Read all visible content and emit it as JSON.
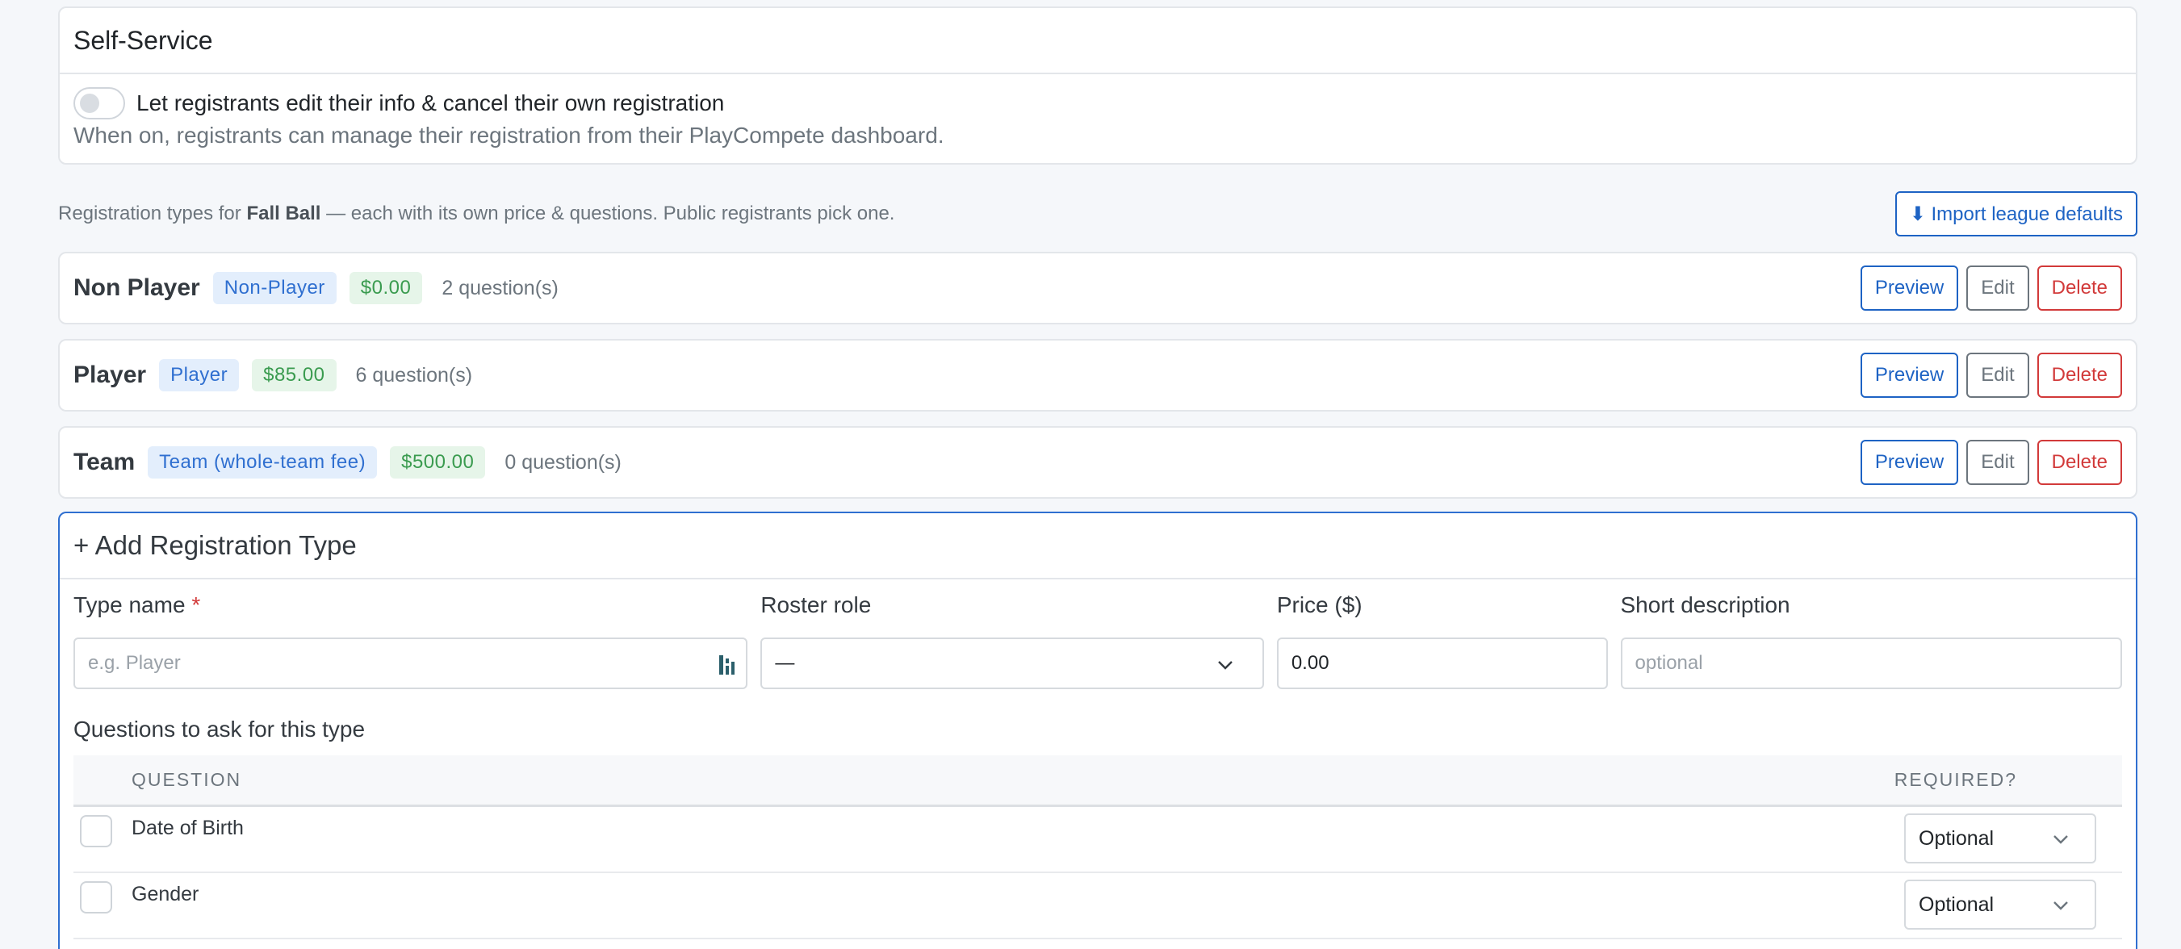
{
  "self_service": {
    "title": "Self-Service",
    "toggle_label": "Let registrants edit their info & cancel their own registration",
    "toggle_on": false,
    "help": "When on, registrants can manage their registration from their PlayCompete dashboard."
  },
  "intro": {
    "prefix": "Registration types for ",
    "league": "Fall Ball",
    "suffix": " — each with its own price & questions. Public registrants pick one.",
    "import_button": "⬇ Import league defaults"
  },
  "types": [
    {
      "name": "Non Player",
      "role": "Non-Player",
      "price": "$0.00",
      "questions": "2 question(s)"
    },
    {
      "name": "Player",
      "role": "Player",
      "price": "$85.00",
      "questions": "6 question(s)"
    },
    {
      "name": "Team",
      "role": "Team (whole-team fee)",
      "price": "$500.00",
      "questions": "0 question(s)"
    }
  ],
  "actions": {
    "preview": "Preview",
    "edit": "Edit",
    "delete": "Delete"
  },
  "add_form": {
    "title": "+ Add Registration Type",
    "type_name_label": "Type name",
    "required_mark": "*",
    "type_name_placeholder": "e.g. Player",
    "roster_role_label": "Roster role",
    "roster_role_value": "—",
    "price_label": "Price ($)",
    "price_value": "0.00",
    "short_desc_label": "Short description",
    "short_desc_placeholder": "optional",
    "questions_title": "Questions to ask for this type",
    "col_question": "QUESTION",
    "col_required": "REQUIRED?",
    "questions": [
      {
        "label": "Date of Birth",
        "required": "Optional"
      },
      {
        "label": "Gender",
        "required": "Optional"
      }
    ]
  },
  "colors": {
    "primary": "#1e63c4",
    "danger": "#d23a3a",
    "success": "#3a9b4f"
  }
}
